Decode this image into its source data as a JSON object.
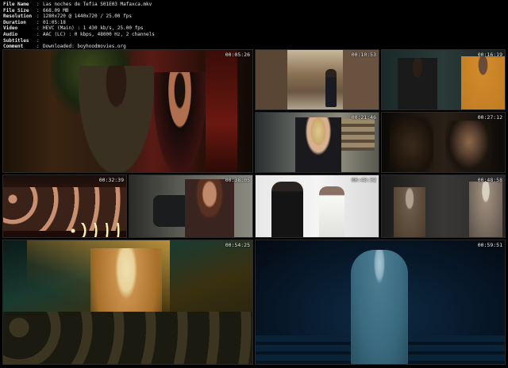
{
  "info": [
    {
      "label": "File Name",
      "value": "Las noches de Tefia S01E03 Mafaxca.mkv"
    },
    {
      "label": "File Size",
      "value": "668.09 MB"
    },
    {
      "label": "Resolution",
      "value": "1280x720 @ 1440x720 / 25.00 fps"
    },
    {
      "label": "Duration",
      "value": "01:05:18"
    },
    {
      "label": "Video",
      "value": "HEVC (Main) : 1 430 kb/s, 25.00 fps"
    },
    {
      "label": "Audio",
      "value": "AAC (LC) : 0 kbps, 48000 Hz, 2 channels"
    },
    {
      "label": "Subtitles",
      "value": ""
    },
    {
      "label": "Comment",
      "value": "Downloaded: boyhoodmovies.org"
    }
  ],
  "thumbnails": [
    {
      "time": "00:05:26",
      "scene": "red-bar-couple"
    },
    {
      "time": "00:10:53",
      "scene": "street"
    },
    {
      "time": "00:16:19",
      "scene": "office-men"
    },
    {
      "time": "00:21:46",
      "scene": "blonde-woman"
    },
    {
      "time": "00:27:12",
      "scene": "dark-man"
    },
    {
      "time": "00:32:39",
      "scene": "audience"
    },
    {
      "time": "00:38:05",
      "scene": "curly-woman"
    },
    {
      "time": "00:43:32",
      "scene": "white-room-men"
    },
    {
      "time": "00:48:58",
      "scene": "dark-room"
    },
    {
      "time": "00:54:25",
      "scene": "stage-performer"
    },
    {
      "time": "00:59:51",
      "scene": "blue-man"
    }
  ]
}
